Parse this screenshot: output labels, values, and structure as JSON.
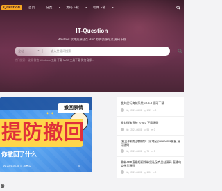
{
  "site": {
    "logo_text": "Question",
    "title": "IT-Question",
    "subtitle": "Windows 软件资源站点 MAC 软件资源站点 源码下载"
  },
  "nav": {
    "items": [
      {
        "label": "首页",
        "has_caret": false
      },
      {
        "label": "分类",
        "has_caret": true
      },
      {
        "label": "源码下载",
        "has_caret": true
      },
      {
        "label": "软件下载",
        "has_caret": true
      }
    ]
  },
  "search": {
    "select_value": "全站",
    "placeholder": "输入关键词搜索",
    "hot_text": "热门搜索：破解 微信 Windows 工具 下载 MAC 工具下载 微信 破解..."
  },
  "banner": {
    "tag_text": "撤回表情",
    "main_text": "提防撤回",
    "sub_text": "你撤回了什么",
    "meta_left": "zy  2021-06-08  ◎ 1k  ♥ 12",
    "meta_right": "⊘"
  },
  "posts": [
    {
      "title": "趣丸优衍商城系统 v2.5.8 源码下载",
      "author": "itq",
      "date": "2021-06-08",
      "views": "122",
      "comments": "0"
    },
    {
      "title": "趣丸微聚系统 v7.6.0 下载源码",
      "author": "itq",
      "date": "2021-06-08",
      "views": "98",
      "comments": "0"
    },
    {
      "title": "[独立手机版]博物馆/厂家地区ipaseeonia模板 复用源码",
      "author": "itq",
      "date": "2021-06-08",
      "views": "76",
      "comments": "0"
    },
    {
      "title": "最新APP直播短视频带货社区商品站源码 直播电商带货源码",
      "author": "itq",
      "date": "2021-06-08",
      "views": "101",
      "comments": "0"
    }
  ],
  "bottom": {
    "label": "最"
  },
  "colors": {
    "hero_bg": "#5a2a40",
    "logo_bg": "#f5a623",
    "banner_bg": "#3a8de8",
    "banner_highlight": "#ffd64a",
    "banner_red": "#e0303a"
  }
}
